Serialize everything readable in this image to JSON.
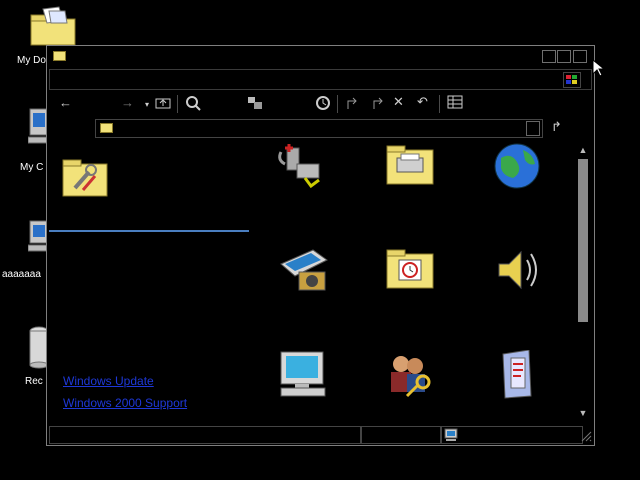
{
  "desktop": {
    "icons": [
      {
        "label": "My Do",
        "icon": "folder-documents-icon"
      },
      {
        "label": "My C",
        "icon": "computer-icon"
      },
      {
        "label": "aaaaaaa",
        "icon": "network-computer-icon"
      },
      {
        "label": "Rec",
        "icon": "recycle-bin-icon"
      }
    ]
  },
  "window": {
    "address_placeholder": "",
    "links": {
      "windows_update": "Windows Update",
      "windows_2000_support": "Windows 2000 Support"
    },
    "content_icons": [
      {
        "name": "admin-tools-folder-icon"
      },
      {
        "name": "add-remove-hardware-icon"
      },
      {
        "name": "printers-folder-icon"
      },
      {
        "name": "internet-options-globe-icon"
      },
      {
        "name": "scanners-cameras-icon"
      },
      {
        "name": "scheduled-tasks-folder-icon"
      },
      {
        "name": "sounds-multimedia-icon"
      },
      {
        "name": "display-monitor-icon"
      },
      {
        "name": "users-passwords-icon"
      },
      {
        "name": "folder-options-icon"
      }
    ]
  },
  "colors": {
    "link": "#1e38d8",
    "divider": "#4a7ec0",
    "folder": "#f2e27a"
  }
}
